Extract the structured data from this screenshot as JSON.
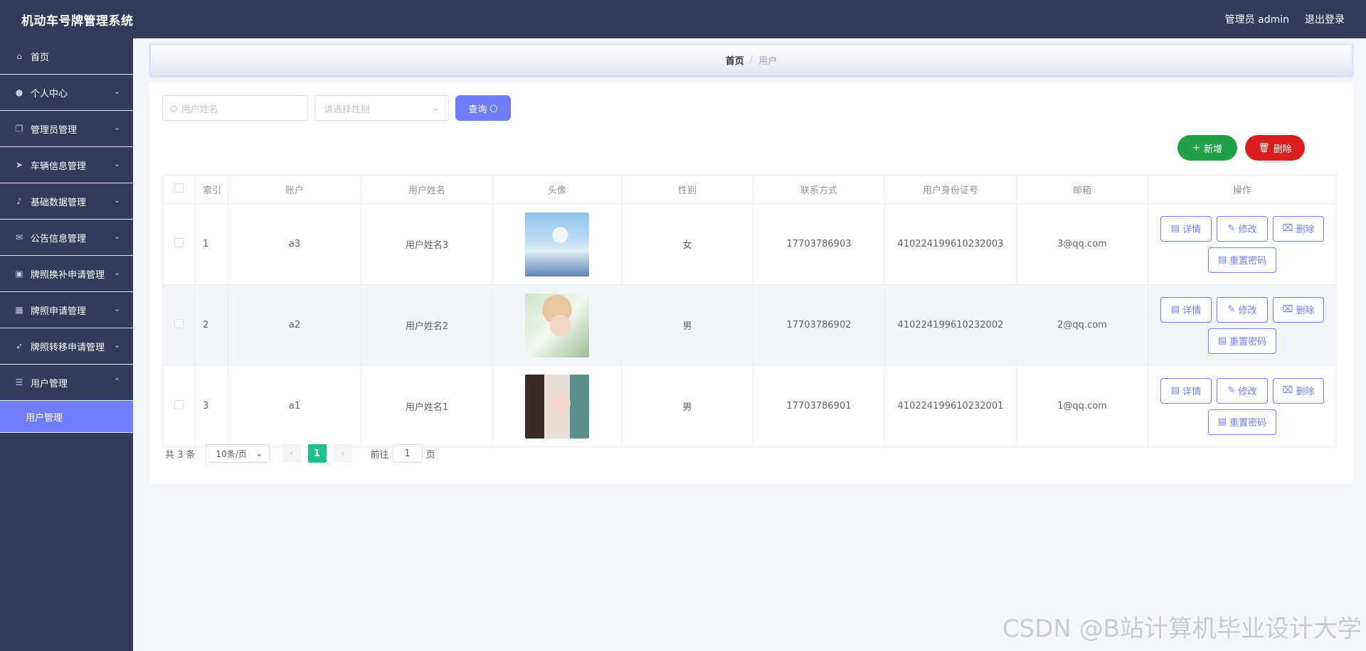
{
  "header": {
    "title": "机动车号牌管理系统",
    "user": "管理员 admin",
    "logout": "退出登录"
  },
  "sidebar": {
    "items": [
      {
        "label": "首页",
        "icon": "home-icon",
        "chevron": false
      },
      {
        "label": "个人中心",
        "icon": "user-icon",
        "chevron": true
      },
      {
        "label": "管理员管理",
        "icon": "copy-icon",
        "chevron": true
      },
      {
        "label": "车辆信息管理",
        "icon": "send-icon",
        "chevron": true
      },
      {
        "label": "基础数据管理",
        "icon": "mic-icon",
        "chevron": true
      },
      {
        "label": "公告信息管理",
        "icon": "mail-icon",
        "chevron": true
      },
      {
        "label": "牌照换补申请管理",
        "icon": "picture-icon",
        "chevron": true
      },
      {
        "label": "牌照申请管理",
        "icon": "grid-icon",
        "chevron": true
      },
      {
        "label": "牌照转移申请管理",
        "icon": "position-icon",
        "chevron": true
      },
      {
        "label": "用户管理",
        "icon": "menu-icon",
        "chevron": true
      }
    ],
    "active_sub": "用户管理"
  },
  "breadcrumb": {
    "home": "首页",
    "separator": "/",
    "current": "用户"
  },
  "search": {
    "name_placeholder": "用户姓名",
    "gender_placeholder": "请选择性别",
    "query_label": "查询"
  },
  "actions": {
    "add": "新增",
    "delete": "删除"
  },
  "table": {
    "headers": [
      "索引",
      "账户",
      "用户姓名",
      "头像",
      "性别",
      "联系方式",
      "用户身份证号",
      "邮箱",
      "操作"
    ],
    "rows": [
      {
        "index": "1",
        "account": "a3",
        "name": "用户姓名3",
        "gender": "女",
        "phone": "17703786903",
        "idcard": "410224199610232003",
        "email": "3@qq.com"
      },
      {
        "index": "2",
        "account": "a2",
        "name": "用户姓名2",
        "gender": "男",
        "phone": "17703786902",
        "idcard": "410224199610232002",
        "email": "2@qq.com"
      },
      {
        "index": "3",
        "account": "a1",
        "name": "用户姓名1",
        "gender": "男",
        "phone": "17703786901",
        "idcard": "410224199610232001",
        "email": "1@qq.com"
      }
    ],
    "row_actions": {
      "detail": "详情",
      "edit": "修改",
      "delete": "删除",
      "reset": "重置密码"
    }
  },
  "pagination": {
    "total": "共 3 条",
    "page_size": "10条/页",
    "current_page": "1",
    "goto_prefix": "前往",
    "goto_value": "1",
    "goto_suffix": "页"
  },
  "watermark": "CSDN @B站计算机毕业设计大学",
  "colors": {
    "sidebar_bg": "#353a5c",
    "accent": "#6f7ffb",
    "add": "#22a047",
    "delete": "#d81e1e",
    "page_active": "#1cc18a"
  }
}
